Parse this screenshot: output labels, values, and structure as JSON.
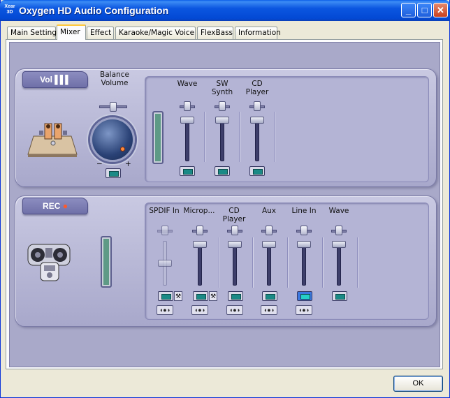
{
  "window": {
    "title": "Oxygen HD Audio Configuration",
    "icon_text": "Xear\n3D"
  },
  "tabs": [
    {
      "label": "Main Setting",
      "active": false
    },
    {
      "label": "Mixer",
      "active": true
    },
    {
      "label": "Effect",
      "active": false
    },
    {
      "label": "Karaoke/Magic Voice",
      "active": false
    },
    {
      "label": "FlexBass",
      "active": false
    },
    {
      "label": "Information",
      "active": false
    }
  ],
  "playback": {
    "plate_label": "Vol",
    "balance_label": "Balance\nVolume",
    "balance_minus": "−",
    "balance_plus": "+",
    "channels": [
      {
        "label": "Wave"
      },
      {
        "label": "SW\nSynth"
      },
      {
        "label": "CD\nPlayer"
      }
    ]
  },
  "record": {
    "plate_label": "REC",
    "channels": [
      {
        "label": "SPDIF In",
        "enabled": false,
        "selected": false
      },
      {
        "label": "Microp...",
        "enabled": true,
        "selected": false
      },
      {
        "label": "CD\nPlayer",
        "enabled": true,
        "selected": false
      },
      {
        "label": "Aux",
        "enabled": true,
        "selected": false
      },
      {
        "label": "Line In",
        "enabled": true,
        "selected": true
      },
      {
        "label": "Wave",
        "enabled": true,
        "selected": false
      }
    ]
  },
  "footer": {
    "ok_label": "OK"
  },
  "colors": {
    "title_bar": "#0b56e0",
    "panel": "#c9c9e2",
    "meter": "#5e9a86",
    "knob_accent": "#ff8a3c"
  },
  "icons": [
    "minimize-icon",
    "maximize-icon",
    "close-icon",
    "speaker-stand-icon",
    "boombox-icon",
    "mute-toggle-icon",
    "settings-wrench-icon",
    "speaker-mute-icon"
  ]
}
